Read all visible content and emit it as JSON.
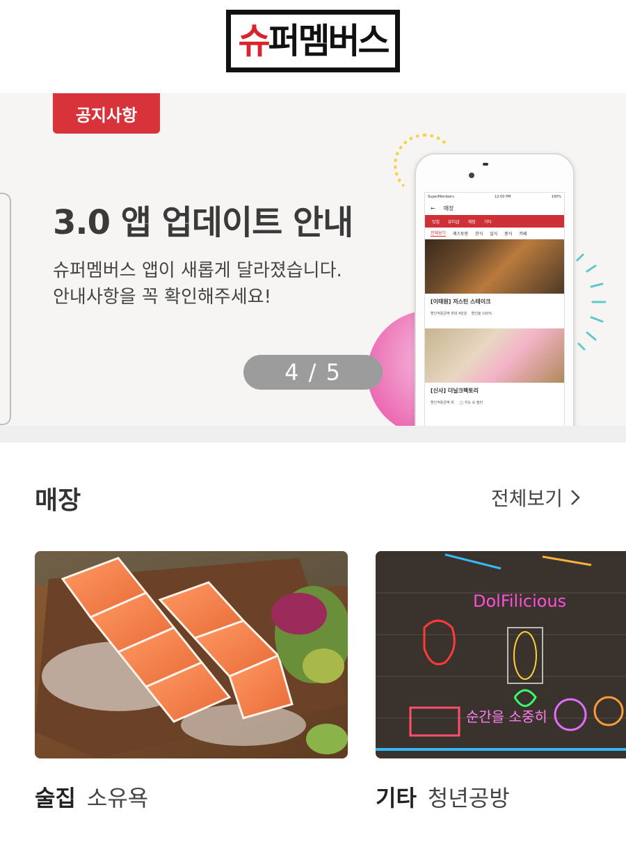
{
  "header": {
    "logo_text": "슈퍼멤버스",
    "brand_color": "#d8242f"
  },
  "banner": {
    "badge": "공지사항",
    "title": "3.0 앱 업데이트 안내",
    "desc_line1": "슈퍼멤버스 앱이 새롭게 달라졌습니다.",
    "desc_line2": "안내사항을 꼭 확인해주세요!",
    "pager": "4 / 5",
    "background": "#f7f5f3",
    "badge_color": "#d8333a"
  },
  "phone_screen": {
    "status_carrier": "SuperMembers",
    "status_time": "12:00 PM",
    "status_battery": "100%",
    "app_title": "매장",
    "categories": [
      "맛집",
      "뷰티샵",
      "체험",
      "기타"
    ],
    "subcategories": [
      "전체보기",
      "레스토랑",
      "한식",
      "일식",
      "중식",
      "카페"
    ],
    "stores": [
      {
        "name": "[이태원] 저스틴 스테이크",
        "meta_label1": "할인적용금액",
        "meta_value1": "최대 4만원",
        "meta_label2": "할인율",
        "meta_value2": "100%"
      },
      {
        "name": "[신사] 더닐크팩토리",
        "meta_label1": "할인적용금액",
        "meta_value1": "최"
      }
    ],
    "bottom_buttons": [
      "지도",
      "필터"
    ]
  },
  "stores_section": {
    "title": "매장",
    "view_all": "전체보기",
    "cards": [
      {
        "category": "술집",
        "name": "소유욕"
      },
      {
        "category": "기타",
        "name": "청년공방"
      }
    ],
    "neon_sign": "DolFilicious",
    "neon_words": "순간을 소중히"
  }
}
